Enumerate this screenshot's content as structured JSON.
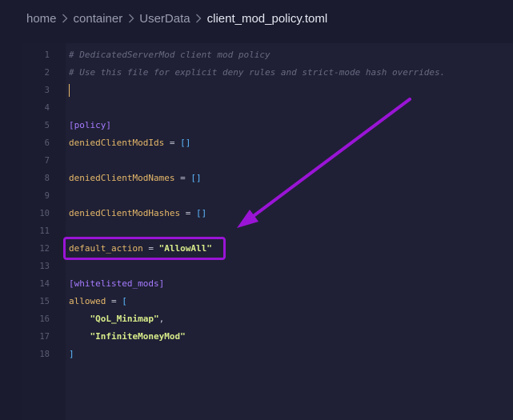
{
  "breadcrumb": {
    "items": [
      "home",
      "container",
      "UserData",
      "client_mod_policy.toml"
    ]
  },
  "editor": {
    "lines": [
      {
        "n": "1",
        "segments": [
          {
            "t": "# DedicatedServerMod client mod policy",
            "c": "comment"
          }
        ]
      },
      {
        "n": "2",
        "segments": [
          {
            "t": "# Use this file for explicit deny rules and strict-mode hash overrides.",
            "c": "comment"
          }
        ]
      },
      {
        "n": "3",
        "segments": [],
        "cursor": true
      },
      {
        "n": "4",
        "segments": []
      },
      {
        "n": "5",
        "segments": [
          {
            "t": "[policy]",
            "c": "section"
          }
        ]
      },
      {
        "n": "6",
        "segments": [
          {
            "t": "deniedClientModIds",
            "c": "key"
          },
          {
            "t": " = ",
            "c": "op"
          },
          {
            "t": "[]",
            "c": "bracket"
          }
        ]
      },
      {
        "n": "7",
        "segments": []
      },
      {
        "n": "8",
        "segments": [
          {
            "t": "deniedClientModNames",
            "c": "key"
          },
          {
            "t": " = ",
            "c": "op"
          },
          {
            "t": "[]",
            "c": "bracket"
          }
        ]
      },
      {
        "n": "9",
        "segments": []
      },
      {
        "n": "10",
        "segments": [
          {
            "t": "deniedClientModHashes",
            "c": "key"
          },
          {
            "t": " = ",
            "c": "op"
          },
          {
            "t": "[]",
            "c": "bracket"
          }
        ]
      },
      {
        "n": "11",
        "segments": []
      },
      {
        "n": "12",
        "segments": [
          {
            "t": "default_action",
            "c": "key"
          },
          {
            "t": " = ",
            "c": "op"
          },
          {
            "t": "\"AllowAll\"",
            "c": "str"
          }
        ],
        "highlighted": true
      },
      {
        "n": "13",
        "segments": []
      },
      {
        "n": "14",
        "segments": [
          {
            "t": "[whitelisted_mods]",
            "c": "section"
          }
        ]
      },
      {
        "n": "15",
        "segments": [
          {
            "t": "allowed",
            "c": "key"
          },
          {
            "t": " = ",
            "c": "op"
          },
          {
            "t": "[",
            "c": "bracket"
          }
        ]
      },
      {
        "n": "16",
        "segments": [
          {
            "t": "    ",
            "c": "op"
          },
          {
            "t": "\"QoL_Minimap\"",
            "c": "str"
          },
          {
            "t": ",",
            "c": "op"
          }
        ]
      },
      {
        "n": "17",
        "segments": [
          {
            "t": "    ",
            "c": "op"
          },
          {
            "t": "\"InfiniteMoneyMod\"",
            "c": "str"
          }
        ]
      },
      {
        "n": "18",
        "segments": [
          {
            "t": "]",
            "c": "bracket"
          }
        ]
      }
    ]
  },
  "colors": {
    "annotation": "#9a14d6",
    "background": "#1a1b2e"
  },
  "icons": {
    "separator": "chevron-right-icon",
    "annotation": "arrow-icon"
  }
}
